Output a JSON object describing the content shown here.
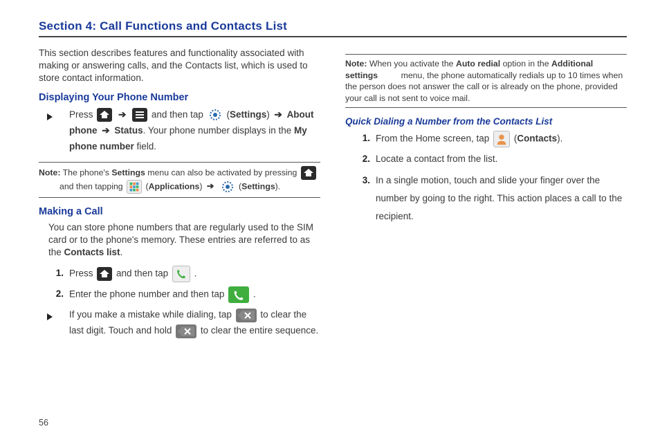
{
  "pageNumber": "56",
  "sectionTitle": "Section 4: Call Functions and Contacts List",
  "intro": "This section describes features and functionality associated with making or answering calls, and the Contacts list, which is used to store contact information.",
  "h_display": "Displaying Your Phone Number",
  "display_step_pre": "Press ",
  "display_step_mid": " and then tap ",
  "label_settings": "Settings",
  "label_about": "About phone",
  "label_status": "Status",
  "display_step_tail": ". Your phone number displays in the ",
  "label_myphone": "My phone number",
  "label_field": " field.",
  "note1_label": "Note:",
  "note1_a": " The phone's ",
  "note1_b": "Settings",
  "note1_c": " menu can also be activated by pressing ",
  "note1_d": " and then tapping ",
  "note1_apps": "Applications",
  "note1_e": " ",
  "note1_set": "Settings",
  "h_making": "Making a Call",
  "making_intro_a": "You can store phone numbers that are regularly used to the SIM card or to the phone's memory. These entries are referred to as the ",
  "making_intro_b": "Contacts list",
  "m1_a": "Press ",
  "m1_b": " and then tap ",
  "m2_a": "Enter the phone number and then tap ",
  "m3_a": "If you make a mistake while dialing, tap ",
  "m3_b": " to clear the last digit. Touch and hold ",
  "m3_c": " to clear the entire sequence.",
  "note2_label": "Note:",
  "note2_a": " When you activate the ",
  "note2_b": "Auto redial",
  "note2_c": " option in the ",
  "note2_d": "Additional settings",
  "note2_e": " menu, the phone automatically redials up to 10 times when the person does not answer the call or is already on the phone, provided your call is not sent to voice mail.",
  "h_quick": "Quick Dialing a Number from the Contacts List",
  "q1_a": "From the Home screen, tap ",
  "q1_b": "Contacts",
  "q2": "Locate a contact from the list.",
  "q3": "In a single motion, touch and slide your finger over the number by going to the right. This action places a call to the recipient.",
  "markers": {
    "one": "1.",
    "two": "2.",
    "three": "3."
  },
  "paren_open": "(",
  "paren_close": ")",
  "period": ".",
  "arrow": "➔"
}
